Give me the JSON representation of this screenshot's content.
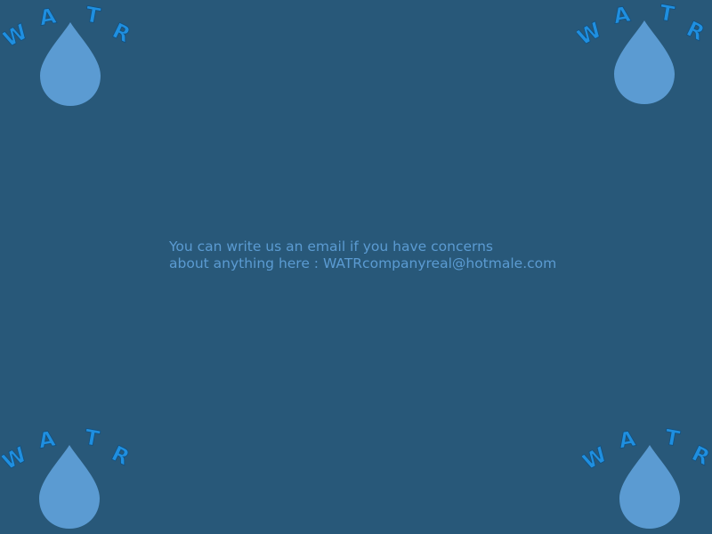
{
  "brand": {
    "logo_letters": [
      "W",
      "A",
      "T",
      "R"
    ],
    "letter_color": "#1f8fe0",
    "drop_color": "#5b9bd2",
    "background_color": "#285879"
  },
  "logos": [
    {
      "name": "logo-top-left"
    },
    {
      "name": "logo-top-right"
    },
    {
      "name": "logo-bottom-left"
    },
    {
      "name": "logo-bottom-right"
    }
  ],
  "message": {
    "line1": "You can write us an email if you have concerns",
    "line2": "about anything here : WATRcompanyreal@hotmale.com"
  }
}
